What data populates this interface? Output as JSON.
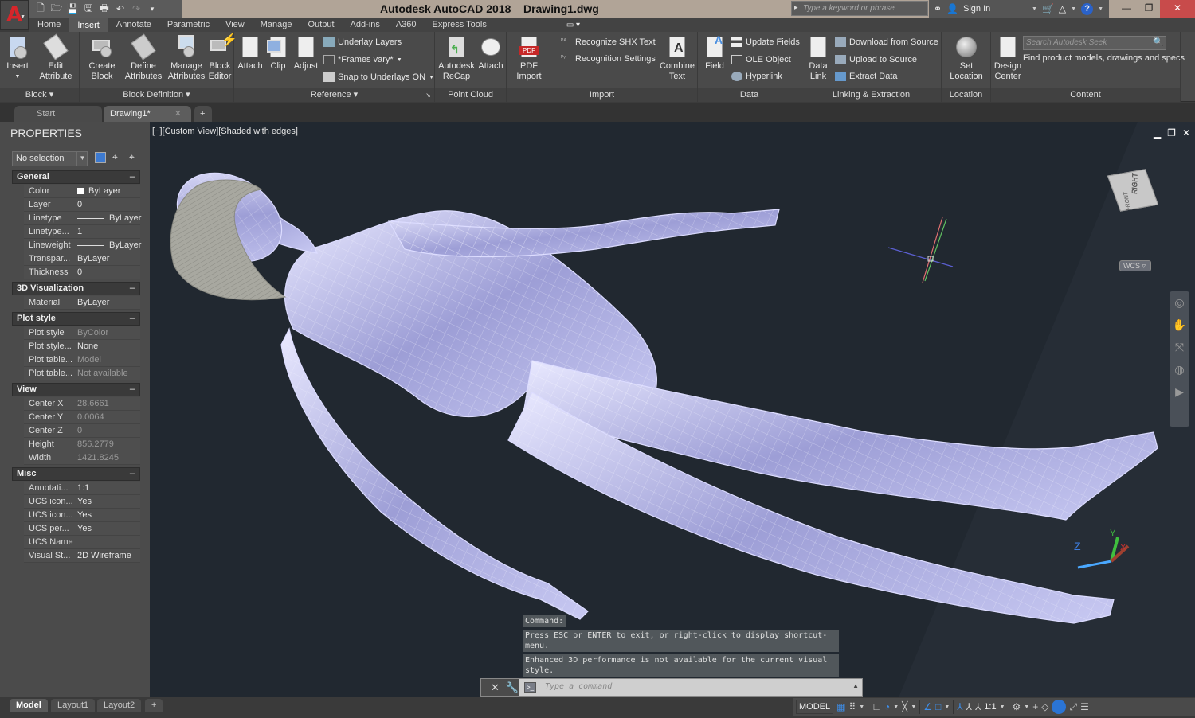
{
  "app": {
    "title": "Autodesk AutoCAD 2018    Drawing1.dwg",
    "logo_letter": "A",
    "search_placeholder": "Type a keyword or phrase",
    "sign_in": "Sign In",
    "quick_access": [
      "new-icon",
      "open-icon",
      "save-icon",
      "save-as-icon",
      "plot-icon",
      "undo-icon",
      "redo-icon",
      "customize-icon"
    ]
  },
  "ribbon_tabs": [
    "Home",
    "Insert",
    "Annotate",
    "Parametric",
    "View",
    "Manage",
    "Output",
    "Add-ins",
    "A360",
    "Express Tools"
  ],
  "active_tab": "Insert",
  "ribbon": {
    "block": {
      "title": "Block",
      "insert": "Insert",
      "edit_attribute_1": "Edit",
      "edit_attribute_2": "Attribute"
    },
    "block_definition": {
      "title": "Block Definition",
      "create_1": "Create",
      "create_2": "Block",
      "define_1": "Define",
      "define_2": "Attributes",
      "manage_1": "Manage",
      "manage_2": "Attributes",
      "editor_1": "Block",
      "editor_2": "Editor"
    },
    "reference": {
      "title": "Reference",
      "attach": "Attach",
      "clip": "Clip",
      "adjust": "Adjust",
      "underlay_layers": "Underlay Layers",
      "frames_vary": "*Frames vary*",
      "snap_underlays": "Snap to Underlays ON"
    },
    "point_cloud": {
      "title": "Point Cloud",
      "recap_1": "Autodesk",
      "recap_2": "ReCap",
      "attach": "Attach"
    },
    "import": {
      "title": "Import",
      "pdf_1": "PDF",
      "pdf_2": "Import",
      "recognize_shx": "Recognize SHX Text",
      "recognition_settings": "Recognition Settings",
      "combine_1": "Combine",
      "combine_2": "Text"
    },
    "data": {
      "title": "Data",
      "field": "Field",
      "update_fields": "Update Fields",
      "ole_object": "OLE Object",
      "hyperlink": "Hyperlink"
    },
    "linking": {
      "title": "Linking & Extraction",
      "data_link_1": "Data",
      "data_link_2": "Link",
      "download": "Download from Source",
      "upload": "Upload to Source",
      "extract": "Extract  Data"
    },
    "location": {
      "title": "Location",
      "set_1": "Set",
      "set_2": "Location"
    },
    "content": {
      "title": "Content",
      "design_1": "Design",
      "design_2": "Center",
      "seek_placeholder": "Search Autodesk Seek",
      "seek_caption": "Find product models, drawings and specs"
    }
  },
  "doc_tabs": [
    {
      "label": "Start"
    },
    {
      "label": "Drawing1*"
    }
  ],
  "properties": {
    "title": "PROPERTIES",
    "selection": "No selection",
    "sections": [
      {
        "name": "General",
        "rows": [
          {
            "k": "Color",
            "v": "ByLayer"
          },
          {
            "k": "Layer",
            "v": "0"
          },
          {
            "k": "Linetype",
            "v": "ByLayer"
          },
          {
            "k": "Linetype...",
            "v": "1"
          },
          {
            "k": "Lineweight",
            "v": "ByLayer"
          },
          {
            "k": "Transpar...",
            "v": "ByLayer"
          },
          {
            "k": "Thickness",
            "v": "0"
          }
        ]
      },
      {
        "name": "3D Visualization",
        "rows": [
          {
            "k": "Material",
            "v": "ByLayer"
          }
        ]
      },
      {
        "name": "Plot style",
        "rows": [
          {
            "k": "Plot style",
            "v": "ByColor"
          },
          {
            "k": "Plot style...",
            "v": "None"
          },
          {
            "k": "Plot table...",
            "v": "Model"
          },
          {
            "k": "Plot table...",
            "v": "Not available"
          }
        ]
      },
      {
        "name": "View",
        "rows": [
          {
            "k": "Center X",
            "v": "28.6661"
          },
          {
            "k": "Center Y",
            "v": "0.0064"
          },
          {
            "k": "Center Z",
            "v": "0"
          },
          {
            "k": "Height",
            "v": "856.2779"
          },
          {
            "k": "Width",
            "v": "1421.8245"
          }
        ]
      },
      {
        "name": "Misc",
        "rows": [
          {
            "k": "Annotati...",
            "v": "1:1"
          },
          {
            "k": "UCS icon...",
            "v": "Yes"
          },
          {
            "k": "UCS icon...",
            "v": "Yes"
          },
          {
            "k": "UCS per...",
            "v": "Yes"
          },
          {
            "k": "UCS Name",
            "v": ""
          },
          {
            "k": "Visual St...",
            "v": "2D Wireframe"
          }
        ]
      }
    ]
  },
  "viewport": {
    "label": "[−][Custom View][Shaded with edges]",
    "viewcube_face_top": "RIGHT",
    "viewcube_face_front": "FRONT",
    "wcs": "WCS",
    "axis_x": "X",
    "axis_y": "Y",
    "axis_z": "Z"
  },
  "command": {
    "history_label": "Command:",
    "msg1": "Press ESC or ENTER to exit, or right-click to display shortcut-menu.",
    "msg2": "Enhanced 3D performance is not available for the current visual style.",
    "placeholder": "Type a command"
  },
  "layout_tabs": [
    "Model",
    "Layout1",
    "Layout2"
  ],
  "status": {
    "model": "MODEL",
    "scale": "1:1"
  }
}
